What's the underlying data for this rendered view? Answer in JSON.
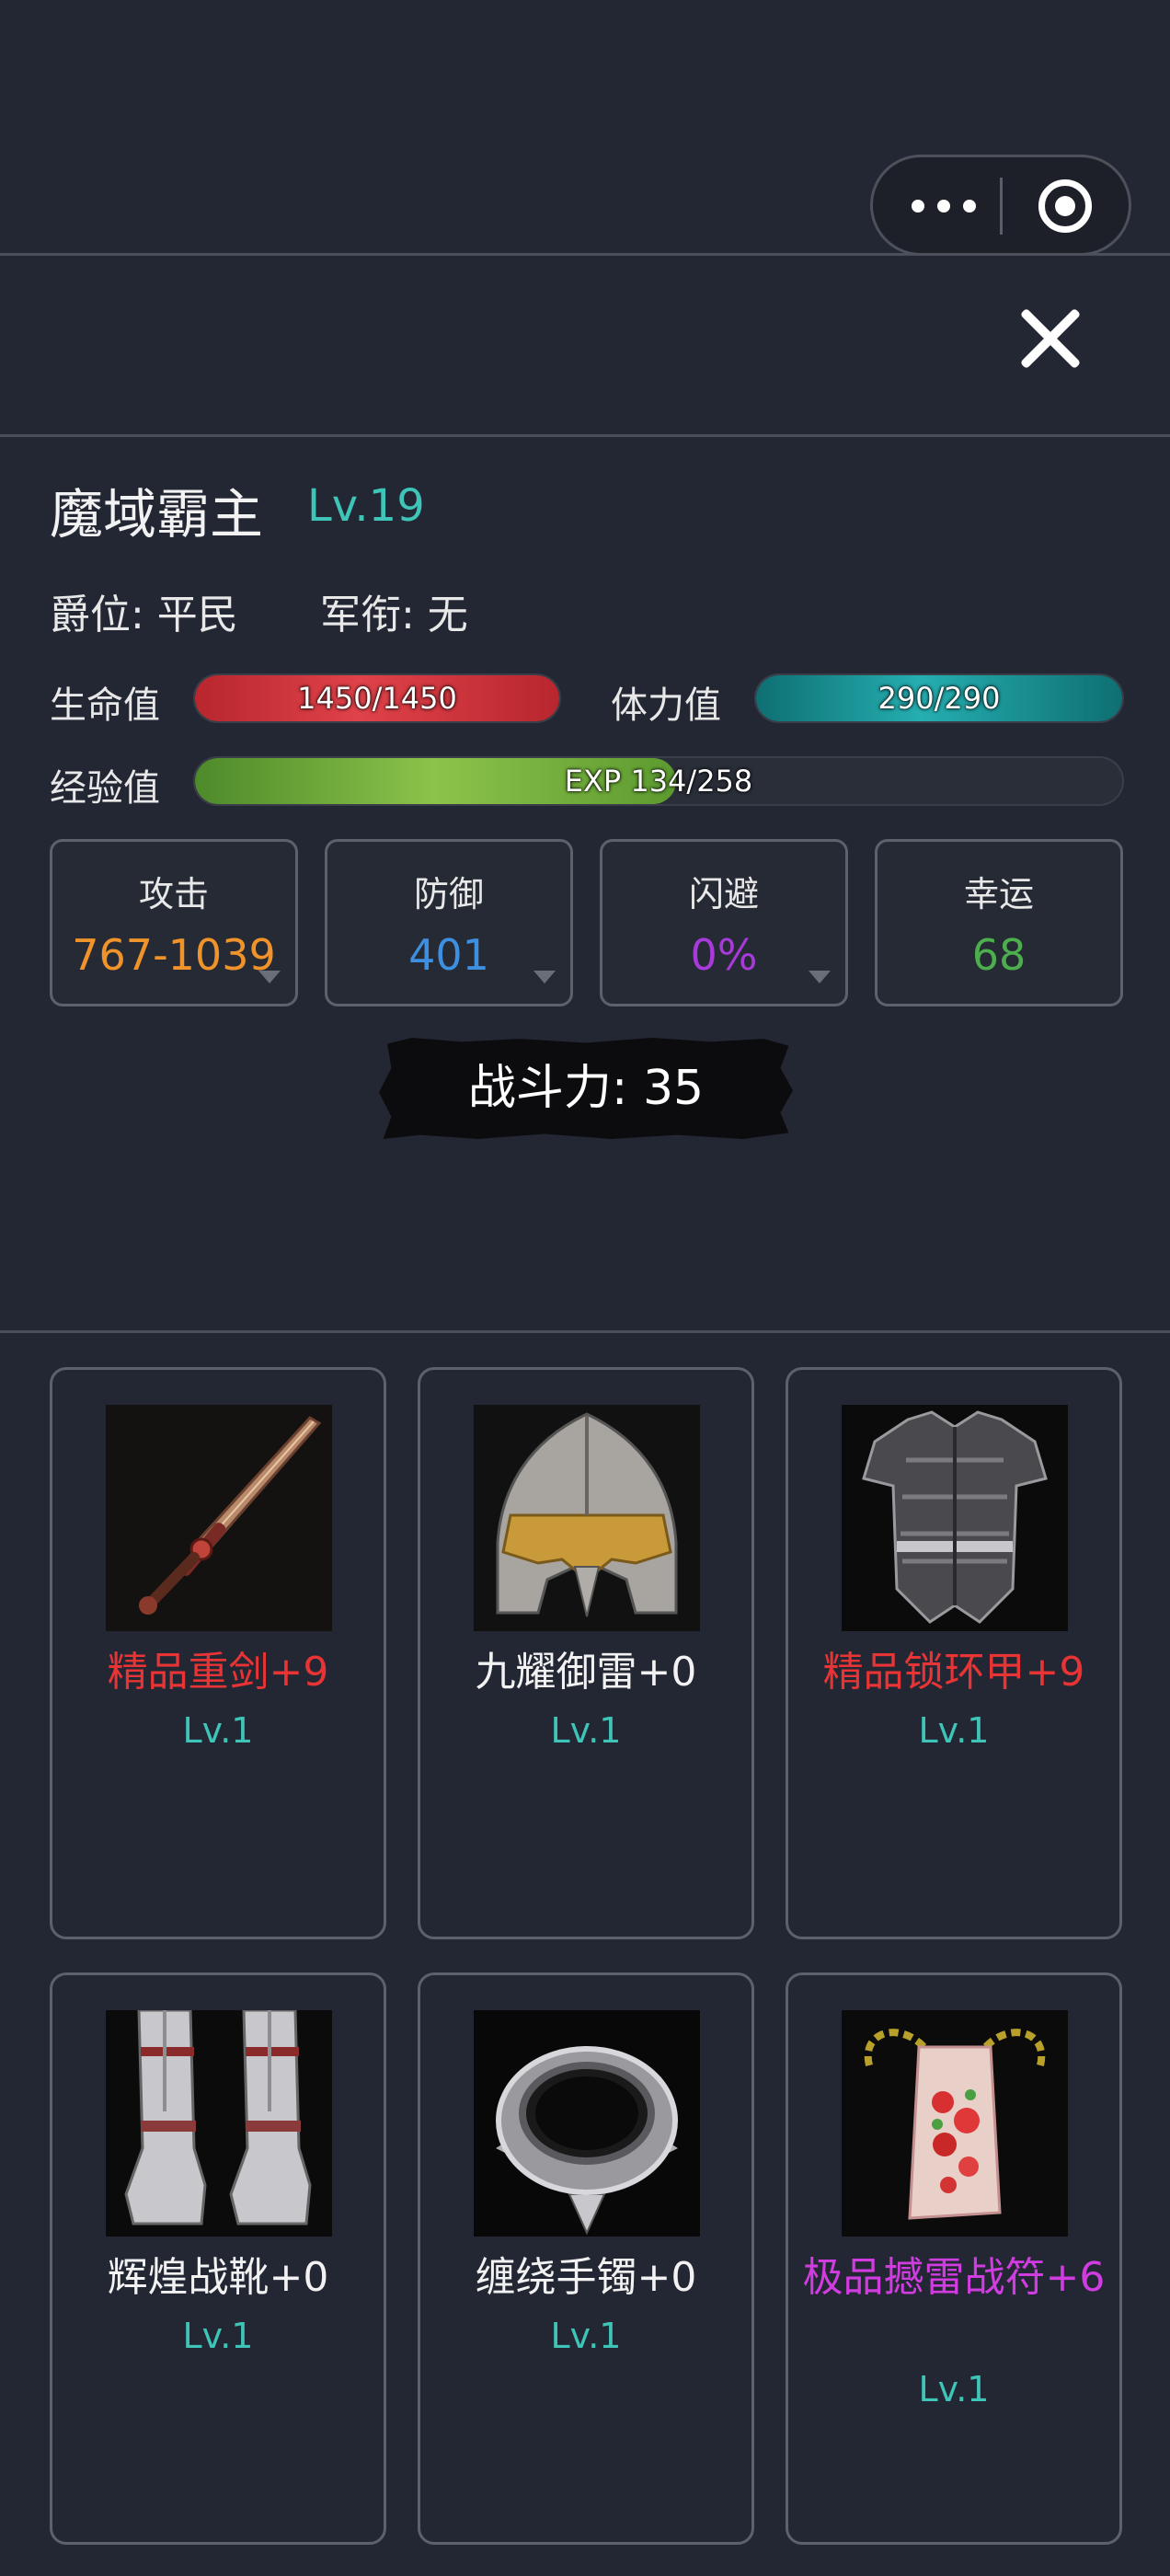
{
  "capsule": {
    "more_icon": "more-dots-icon",
    "target_icon": "target-icon"
  },
  "close_icon": "close-icon",
  "player": {
    "name": "魔域霸主",
    "level": "Lv.19",
    "rank": "爵位: 平民",
    "title": "军衔: 无"
  },
  "bars": {
    "hp": {
      "label": "生命值",
      "text": "1450/1450",
      "fraction": 1.0,
      "color": "#e04249"
    },
    "sp": {
      "label": "体力值",
      "text": "290/290",
      "fraction": 1.0,
      "color": "#25aeb0"
    },
    "xp": {
      "label": "经验值",
      "text": "EXP 134/258",
      "fraction": 0.519,
      "color": "#8cc34a"
    }
  },
  "stats": [
    {
      "label": "攻击",
      "value": "767-1039",
      "color": "#f0932b",
      "has_arrow": true
    },
    {
      "label": "防御",
      "value": "401",
      "color": "#3d8fe0",
      "has_arrow": true
    },
    {
      "label": "闪避",
      "value": "0%",
      "color": "#a73ad8",
      "has_arrow": true
    },
    {
      "label": "幸运",
      "value": "68",
      "color": "#4cae4c",
      "has_arrow": false
    }
  ],
  "power": "战斗力: 35",
  "equipment": [
    {
      "name": "精品重剑+9",
      "level": "Lv.1",
      "color": "#e83434",
      "icon": "sword-icon"
    },
    {
      "name": "九耀御雷+0",
      "level": "Lv.1",
      "color": "#f2f2f2",
      "icon": "helmet-icon"
    },
    {
      "name": "精品锁环甲+9",
      "level": "Lv.1",
      "color": "#e83434",
      "icon": "armor-icon"
    },
    {
      "name": "辉煌战靴+0",
      "level": "Lv.1",
      "color": "#f2f2f2",
      "icon": "boots-icon"
    },
    {
      "name": "缠绕手镯+0",
      "level": "Lv.1",
      "color": "#f2f2f2",
      "icon": "bracelet-icon"
    },
    {
      "name": "极品撼雷战符+6",
      "level": "Lv.1",
      "color": "#d13ce0",
      "icon": "amulet-icon"
    }
  ]
}
